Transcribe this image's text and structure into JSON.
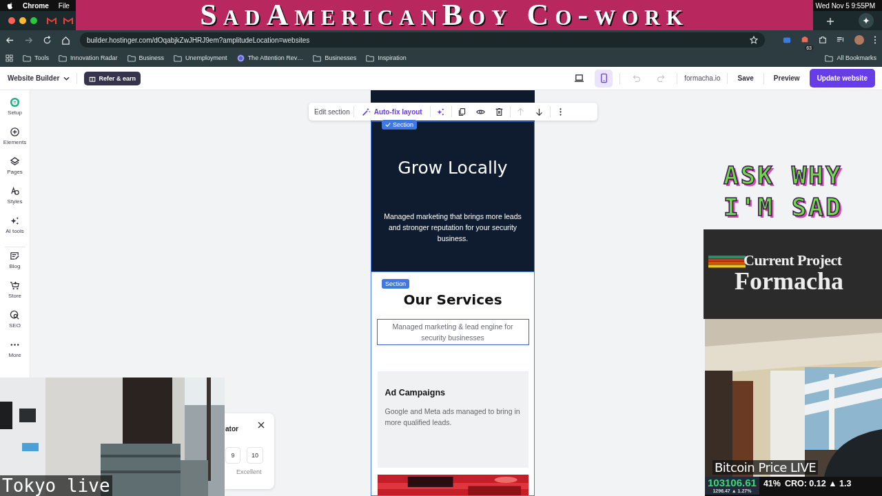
{
  "menubar": {
    "app": "Chrome",
    "menus": [
      "File"
    ],
    "clock": "Wed Nov 5  9:55PM"
  },
  "browser": {
    "url": "builder.hostinger.com/dOqabjkZwJHRJ9em?amplitudeLocation=websites",
    "extension_badge": "63",
    "bookmarks": [
      {
        "label": "Tools",
        "kind": "folder"
      },
      {
        "label": "Innovation Radar",
        "kind": "folder"
      },
      {
        "label": "Business",
        "kind": "folder"
      },
      {
        "label": "Unemployment",
        "kind": "folder"
      },
      {
        "label": "The Attention Rev…",
        "kind": "site"
      },
      {
        "label": "Businesses",
        "kind": "folder"
      },
      {
        "label": "Inspiration",
        "kind": "folder"
      }
    ],
    "all_bookmarks": "All Bookmarks"
  },
  "builder": {
    "title": "Website Builder",
    "refer": "Refer & earn",
    "devices": [
      {
        "kind": "desktop",
        "selected": false
      },
      {
        "kind": "mobile",
        "selected": true
      }
    ],
    "history": [
      {
        "kind": "undo",
        "disabled": true
      },
      {
        "kind": "redo",
        "disabled": true
      }
    ],
    "domain": "formacha.io",
    "save": "Save",
    "preview": "Preview",
    "update": "Update website"
  },
  "sidebar": {
    "items": [
      {
        "label": "Setup",
        "kind": "setup",
        "selected": true
      },
      {
        "label": "Elements",
        "kind": "elements",
        "selected": false
      },
      {
        "label": "Pages",
        "kind": "pages",
        "selected": false
      },
      {
        "label": "Styles",
        "kind": "styles",
        "selected": false
      },
      {
        "label": "AI tools",
        "kind": "ai",
        "selected": false
      },
      {
        "label": "Blog",
        "kind": "blog",
        "selected": false
      },
      {
        "label": "Store",
        "kind": "store",
        "selected": false
      },
      {
        "label": "SEO",
        "kind": "seo",
        "selected": false
      },
      {
        "label": "More",
        "kind": "more",
        "selected": false
      }
    ]
  },
  "toolbar": {
    "edit": "Edit section",
    "autofix": "Auto-fix layout",
    "actions": [
      {
        "kind": "ai",
        "disabled": false
      },
      {
        "kind": "duplicate",
        "disabled": false
      },
      {
        "kind": "hide",
        "disabled": false
      },
      {
        "kind": "delete",
        "disabled": false
      },
      {
        "kind": "up",
        "disabled": true
      },
      {
        "kind": "down",
        "disabled": false
      },
      {
        "kind": "more",
        "disabled": false
      }
    ]
  },
  "preview": {
    "hero": {
      "badge": {
        "label": "Section",
        "checked": true
      },
      "title": "Grow Locally",
      "text": "Managed marketing that brings more leads and stronger reputation for your security business."
    },
    "services": {
      "badge": {
        "label": "Section",
        "checked": false
      },
      "title": "Our Services",
      "subtitle": "Managed marketing & lead engine for security businesses",
      "cards": [
        {
          "title": "Ad Campaigns",
          "text": "Google and Meta ads managed to bring in more qualified leads."
        }
      ]
    }
  },
  "popup": {
    "title": "ator",
    "options": [
      "9",
      "10"
    ],
    "scale_label": "Excellent"
  },
  "overlays": {
    "banner": "SadAmericanBoy Co-work",
    "tagline": [
      "ASK WHY",
      "I'M SAD"
    ],
    "project": {
      "label": "Current Project",
      "name": "Formacha"
    },
    "tokyo": {
      "caption": "Tokyo live"
    },
    "ticker": {
      "title": "Bitcoin Price LIVE",
      "price": "103106.61",
      "change": "1296.47 ▲ 1.27%",
      "items": [
        "41%",
        "CRO: 0.12 ▲ 1.3"
      ]
    }
  }
}
